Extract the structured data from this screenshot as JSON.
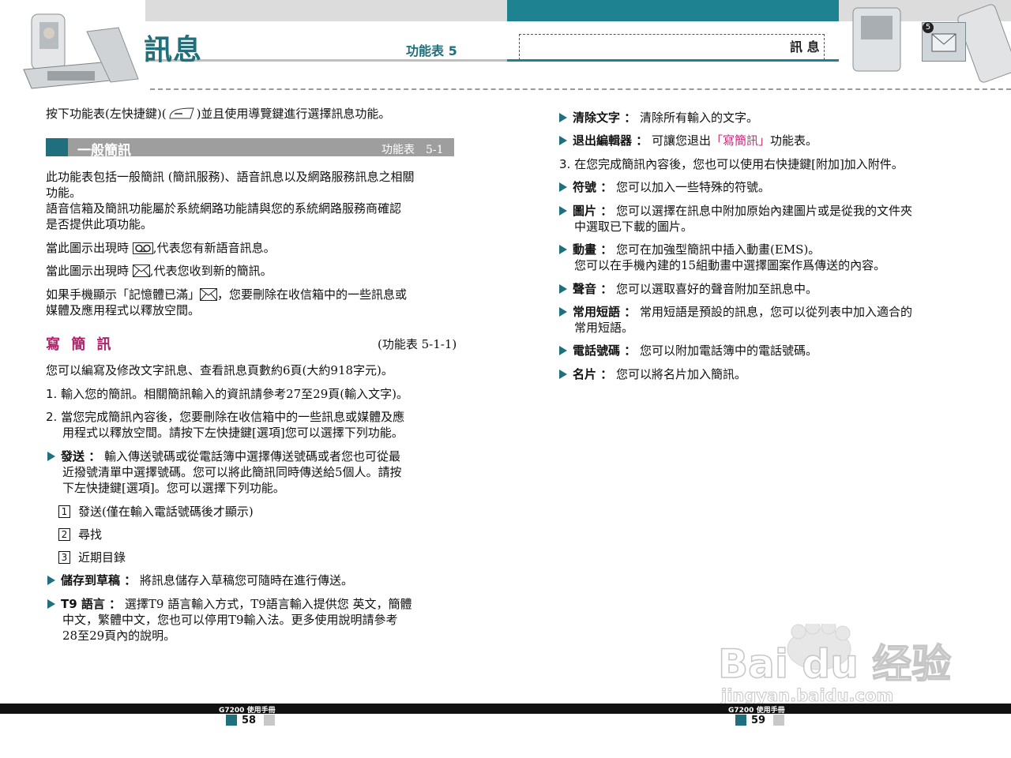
{
  "header": {
    "title": "訊息",
    "subtitle": "功能表 5",
    "right_label": "訊 息",
    "badge_number": "5"
  },
  "left": {
    "intro": "按下功能表(左快捷鍵)(",
    "intro_tail": ")並且使用導覽鍵進行選擇訊息功能。",
    "section_bar": {
      "title": "一般簡訊",
      "ref": "功能表　5-1"
    },
    "para1_l1": "此功能表包括一般簡訊 (簡訊服務)、語音訊息以及網路服務訊息之相關",
    "para1_l2": "功能。",
    "para1_l3": "語音信箱及簡訊功能屬於系統網路功能請與您的系統網路服務商確認",
    "para1_l4": "是否提供此項功能。",
    "voicemail_a": "當此圖示出現時",
    "voicemail_b": ",代表您有新語音訊息。",
    "sms_a": "當此圖示出現時",
    "sms_b": ",代表您收到新的簡訊。",
    "full_a": "如果手機顯示「記憶體已滿」",
    "full_b": "，您要刪除在收信箱中的一些訊息或",
    "full_l2": "媒體及應用程式以釋放空間。",
    "write": {
      "title": "寫 簡 訊",
      "ref": "(功能表 5-1-1)"
    },
    "write_desc": "您可以編寫及修改文字訊息、查看訊息頁數約6頁(大約918字元)。",
    "step1_num": "1.",
    "step1": "輸入您的簡訊。相關簡訊輸入的資訊請參考27至29頁(輸入文字)。",
    "step2_num": "2.",
    "step2_l1": "當您完成簡訊內容後，您要刪除在收信箱中的一些訊息或媒體及應",
    "step2_l2": "用程式以釋放空間。請按下左快捷鍵[選項]您可以選擇下列功能。",
    "send_label": "發送 ：",
    "send_l1": "輸入傳送號碼或從電話簿中選擇傳送號碼或者您也可從最",
    "send_l2": "近撥號清單中選擇號碼。您可以將此簡訊同時傳送給5個人。請按",
    "send_l3": "下左快捷鍵[選項]。您可以選擇下列功能。",
    "sub_items": [
      {
        "num": "1",
        "text": "發送(僅在輸入電話號碼後才顯示)"
      },
      {
        "num": "2",
        "text": "尋找"
      },
      {
        "num": "3",
        "text": "近期目錄"
      }
    ],
    "draft_label": "儲存到草稿 ：",
    "draft_text": "將訊息儲存入草稿您可隨時在進行傳送。",
    "t9_label": "T9 語言 ：",
    "t9_l1": "選擇T9 語言輸入方式，T9語言輸入提供您 英文，簡體",
    "t9_l2": "中文，繁體中文，您也可以停用T9輸入法。更多使用說明請參考",
    "t9_l3": "28至29頁內的說明。"
  },
  "right": {
    "clear_label": "清除文字 ：",
    "clear_text": "清除所有輸入的文字。",
    "exit_label": "退出編輯器 ：",
    "exit_a": "可讓您退出",
    "exit_link": "「寫簡訊」",
    "exit_b": "功能表。",
    "step3_num": "3.",
    "step3": "在您完成簡訊內容後，您也可以使用右快捷鍵[附加]加入附件。",
    "symbol_label": "符號 ：",
    "symbol_text": "您可以加入一些特殊的符號。",
    "picture_label": "圖片 ：",
    "picture_l1": "您可以選擇在訊息中附加原始內建圖片或是從我的文件夾",
    "picture_l2": "中選取已下載的圖片。",
    "anim_label": "動畫 ：",
    "anim_l1": "您可在加強型簡訊中插入動畫(EMS)。",
    "anim_l2": "您可以在手機內建的15組動畫中選擇圖案作爲傳送的內容。",
    "sound_label": "聲音 ：",
    "sound_text": "您可以選取喜好的聲音附加至訊息中。",
    "phrase_label": "常用短語 ：",
    "phrase_l1": "常用短語是預設的訊息，您可以從列表中加入適合的",
    "phrase_l2": "常用短語。",
    "phone_label": "電話號碼 ：",
    "phone_text": "您可以附加電話簿中的電話號碼。",
    "card_label": "名片 ：",
    "card_text": "您可以將名片加入簡訊。"
  },
  "footer": {
    "left_manual": "G7200 使用手冊",
    "left_page": "58",
    "right_manual": "G7200 使用手冊",
    "right_page": "59"
  },
  "watermark": {
    "text": "Bai du 经验",
    "url": "jingyan.baidu.com"
  },
  "colors": {
    "accent": "#1f6f7c",
    "teal_band": "#1f8290",
    "section_pink": "#b0236b",
    "bar_gray": "#9e9e9e"
  }
}
